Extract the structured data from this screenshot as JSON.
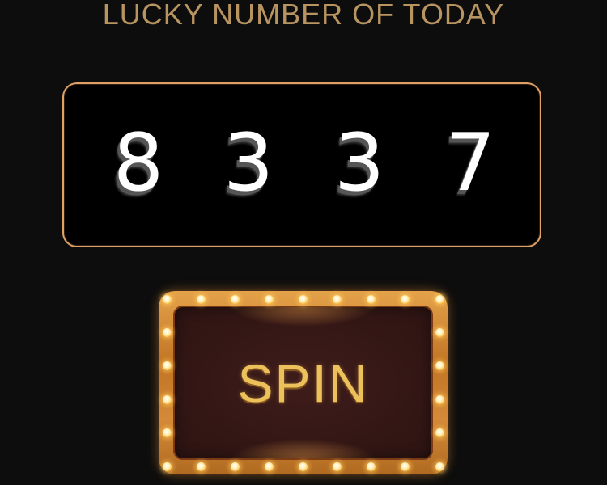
{
  "header": {
    "title": "LUCKY NUMBER OF TODAY"
  },
  "lucky_number": {
    "digits": [
      "8",
      "3",
      "3",
      "7"
    ]
  },
  "spin_button": {
    "label": "SPIN"
  },
  "colors": {
    "background": "#0d0d0d",
    "title": "#b89460",
    "panel_border": "#e0a166",
    "spin_label": "#ecc15c",
    "spin_frame": "#c17424",
    "spin_fill": "#2d1412"
  },
  "icons": {
    "marquee_lights": "light-bulb-icon"
  }
}
